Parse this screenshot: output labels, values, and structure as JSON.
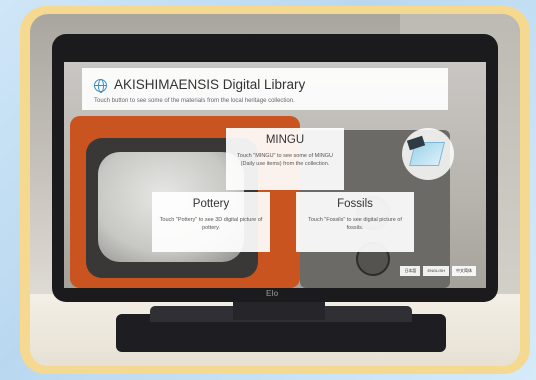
{
  "header": {
    "title": "AKISHIMAENSIS Digital Library",
    "subtitle": "Touch button to see some of the materials from the local heritage collection."
  },
  "cards": [
    {
      "title": "MINGU",
      "desc": "Touch \"MINGU\" to see some of MINGU (Daily use items) from the collection."
    },
    {
      "title": "Pottery",
      "desc": "Touch \"Pottery\" to see 3D digital picture of pottery."
    },
    {
      "title": "Fossils",
      "desc": "Touch \"Fossils\" to see digital picture of fossils."
    }
  ],
  "lang_buttons": [
    "日本語",
    "ENGLISH",
    "中文简体"
  ],
  "bezel_logo": "Elo"
}
